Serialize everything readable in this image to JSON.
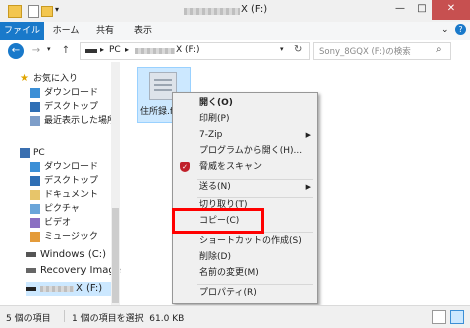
{
  "window": {
    "title_suffix": "X (F:)",
    "controls": [
      "—",
      "□",
      "✕"
    ]
  },
  "ribbon": {
    "tabs": [
      "ファイル",
      "ホーム",
      "共有",
      "表示"
    ]
  },
  "address": {
    "segments": [
      "PC",
      "X (F:)"
    ],
    "search_placeholder": "Sony_8GQX (F:)の検索"
  },
  "nav": {
    "favorites": "お気に入り",
    "fav_items": [
      "ダウンロード",
      "デスクトップ",
      "最近表示した場所"
    ],
    "pc": "PC",
    "pc_items": [
      "ダウンロード",
      "デスクトップ",
      "ドキュメント",
      "ピクチャ",
      "ビデオ",
      "ミュージック",
      "Windows (C:)",
      "Recovery Image"
    ],
    "drive": "X (F:)"
  },
  "file": {
    "name": "住所録.f"
  },
  "context_menu": {
    "items": [
      {
        "label": "開く(O)",
        "bold": true
      },
      {
        "label": "印刷(P)"
      },
      {
        "label": "7-Zip",
        "submenu": true
      },
      {
        "label": "プログラムから開く(H)..."
      },
      {
        "label": "脅威をスキャン"
      },
      {
        "label": "送る(N)",
        "submenu": true
      },
      {
        "label": "切り取り(T)"
      },
      {
        "label": "コピー(C)"
      },
      {
        "label": "ショートカットの作成(S)"
      },
      {
        "label": "削除(D)"
      },
      {
        "label": "名前の変更(M)"
      },
      {
        "label": "プロパティ(R)"
      }
    ]
  },
  "status": {
    "count": "5 個の項目",
    "selection": "1 個の項目を選択  61.0 KB"
  },
  "colors": {
    "accent": "#1979ca",
    "highlight_box": "#ff0000",
    "selected_fill": "#cce8ff"
  }
}
